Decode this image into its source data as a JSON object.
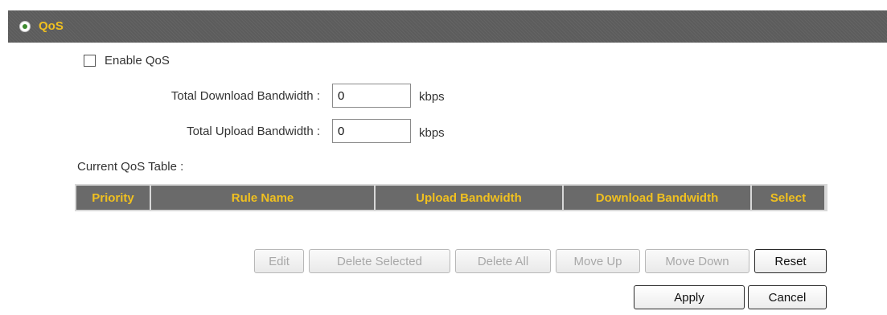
{
  "section": {
    "title": "QoS",
    "icon": "radio-dot-icon"
  },
  "enable_qos": {
    "label": "Enable QoS",
    "checked": false
  },
  "download": {
    "label": "Total Download Bandwidth :",
    "value": "0",
    "unit": "kbps"
  },
  "upload": {
    "label": "Total Upload Bandwidth :",
    "value": "0",
    "unit": "kbps"
  },
  "table": {
    "caption": "Current QoS Table :",
    "columns": [
      "Priority",
      "Rule Name",
      "Upload Bandwidth",
      "Download Bandwidth",
      "Select"
    ],
    "rows": []
  },
  "buttons": {
    "edit": "Edit",
    "delete_selected": "Delete Selected",
    "delete_all": "Delete All",
    "move_up": "Move Up",
    "move_down": "Move Down",
    "reset": "Reset",
    "apply": "Apply",
    "cancel": "Cancel"
  },
  "colors": {
    "header_bg": "#5c5c5c",
    "header_text": "#f0c020",
    "icon_dot": "#3d8b2f"
  }
}
